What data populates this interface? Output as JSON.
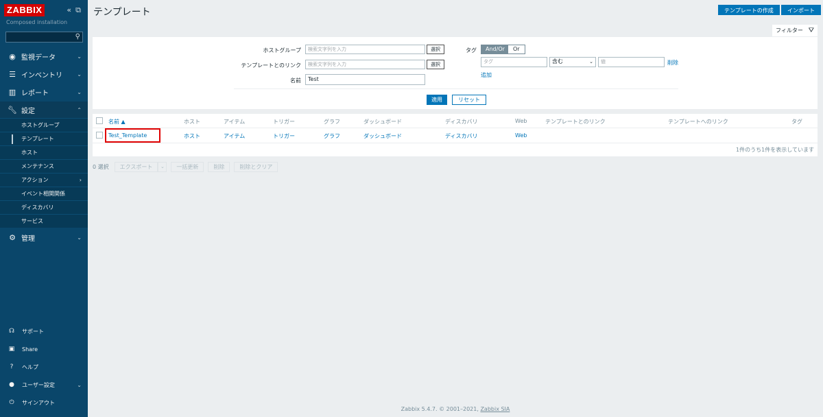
{
  "sidebar": {
    "logo": "ZABBIX",
    "subtitle": "Composed installation",
    "search_value": "",
    "menu": [
      {
        "label": "監視データ",
        "icon": "eye-icon"
      },
      {
        "label": "インベントリ",
        "icon": "list-icon"
      },
      {
        "label": "レポート",
        "icon": "chart-icon"
      },
      {
        "label": "設定",
        "icon": "wrench-icon"
      },
      {
        "label": "管理",
        "icon": "gear-icon"
      }
    ],
    "submenu": [
      "ホストグループ",
      "テンプレート",
      "ホスト",
      "メンテナンス",
      "アクション",
      "イベント相関関係",
      "ディスカバリ",
      "サービス"
    ],
    "bottom": [
      {
        "label": "サポート",
        "icon": "headset-icon"
      },
      {
        "label": "Share",
        "icon": "share-icon"
      },
      {
        "label": "ヘルプ",
        "icon": "help-icon"
      },
      {
        "label": "ユーザー設定",
        "icon": "user-icon"
      },
      {
        "label": "サインアウト",
        "icon": "power-icon"
      }
    ]
  },
  "header": {
    "title": "テンプレート",
    "create_button": "テンプレートの作成",
    "import_button": "インポート"
  },
  "filter": {
    "tab_label": "フィルター",
    "host_group_label": "ホストグループ",
    "host_group_placeholder": "検索文字列を入力",
    "linked_templates_label": "テンプレートとのリンク",
    "linked_templates_placeholder": "検索文字列を入力",
    "select_button": "選択",
    "name_label": "名前",
    "name_value": "Test",
    "tag_label": "タグ",
    "andor": "And/Or",
    "or": "Or",
    "tag_placeholder": "タグ",
    "operator": "含む",
    "value_placeholder": "値",
    "remove_link": "削除",
    "add_link": "追加",
    "apply_button": "適用",
    "reset_button": "リセット"
  },
  "table": {
    "headers": {
      "name": "名前 ▲",
      "hosts": "ホスト",
      "items": "アイテム",
      "triggers": "トリガー",
      "graphs": "グラフ",
      "dashboards": "ダッシュボード",
      "discovery": "ディスカバリ",
      "web": "Web",
      "linked_templates": "テンプレートとのリンク",
      "linked_to": "テンプレートへのリンク",
      "tags": "タグ"
    },
    "rows": [
      {
        "name": "Test_Template",
        "hosts": "ホスト",
        "items": "アイテム",
        "triggers": "トリガー",
        "graphs": "グラフ",
        "dashboards": "ダッシュボード",
        "discovery": "ディスカバリ",
        "web": "Web"
      }
    ],
    "summary": "1件のうち1件を表示しています"
  },
  "actions": {
    "selected": "0 選択",
    "export": "エクスポート",
    "mass_update": "一括更新",
    "delete": "削除",
    "delete_clear": "削除とクリア"
  },
  "footer": {
    "text": "Zabbix 5.4.7. © 2001–2021, ",
    "link": "Zabbix SIA"
  },
  "colors": {
    "sidebar_bg": "#0a466a",
    "primary": "#0275b8",
    "logo_red": "#d40000",
    "highlight": "#e00000"
  }
}
